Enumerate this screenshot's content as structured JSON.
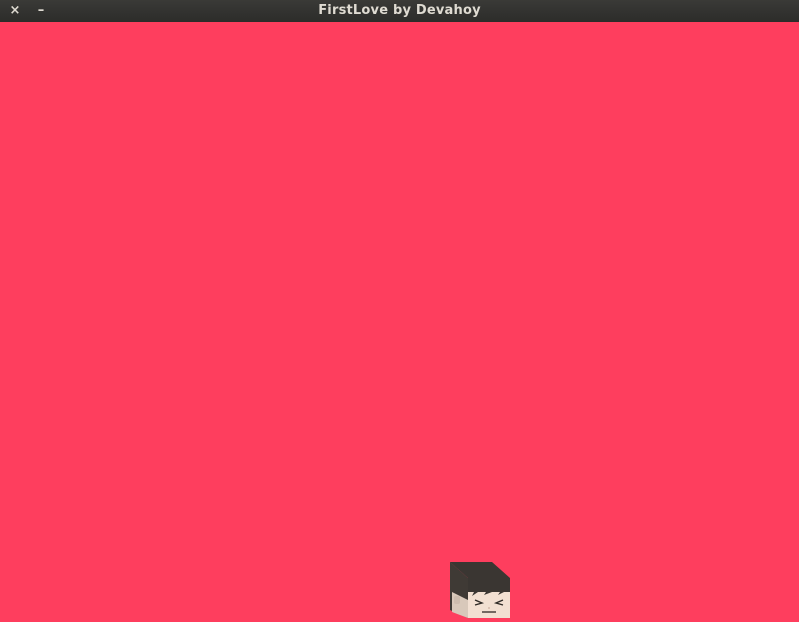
{
  "window": {
    "title": "FirstLove by Devahoy",
    "close_glyph": "×",
    "minimize_glyph": "–"
  },
  "colors": {
    "titlebar": "#2e2e2c",
    "background": "#fe3e5e",
    "hair": "#3a3632",
    "skin": "#f2e0d2"
  },
  "icons": {
    "close": "close-icon",
    "minimize": "minimize-icon",
    "player": "player-head-icon"
  }
}
